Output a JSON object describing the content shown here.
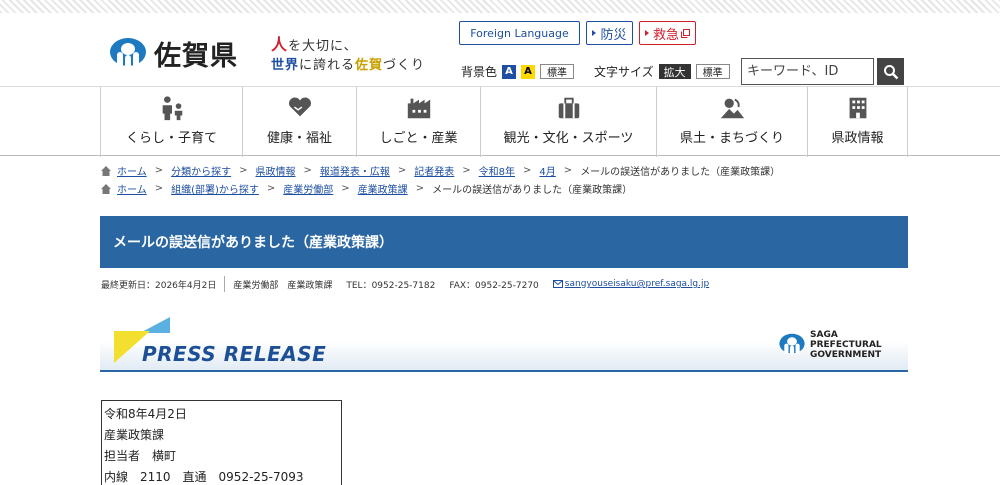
{
  "header": {
    "logo_text": "佐賀県",
    "slogan": {
      "line1_a": "人",
      "line1_b": "を大切に、",
      "line2_a": "世界",
      "line2_b": "に誇れる",
      "line2_c": "佐賀",
      "line2_d": "づくり"
    },
    "foreign_language": "Foreign Language",
    "bousai": "防災",
    "kyukyu": "救急",
    "bgcolor_label": "背景色",
    "bgcolor_blue": "A",
    "bgcolor_yellow": "A",
    "bgcolor_standard": "標準",
    "fontsize_label": "文字サイズ",
    "fontsize_enlarge": "拡大",
    "fontsize_standard": "標準",
    "search_placeholder": "キーワード、ID"
  },
  "nav": {
    "items": [
      {
        "label": "くらし・子育て",
        "icon": "family-icon"
      },
      {
        "label": "健康・福祉",
        "icon": "heart-hands-icon"
      },
      {
        "label": "しごと・産業",
        "icon": "factory-icon"
      },
      {
        "label": "観光・文化・スポーツ",
        "icon": "suitcase-icon"
      },
      {
        "label": "県土・まちづくり",
        "icon": "landscape-icon"
      },
      {
        "label": "県政情報",
        "icon": "building-icon"
      }
    ]
  },
  "breadcrumb1": [
    "ホーム",
    "分類から探す",
    "県政情報",
    "報道発表・広報",
    "記者発表",
    "令和8年",
    "4月",
    "メールの誤送信がありました（産業政策課）"
  ],
  "breadcrumb2": [
    "ホーム",
    "組織(部署)から探す",
    "産業労働部",
    "産業政策課",
    "メールの誤送信がありました（産業政策課）"
  ],
  "page": {
    "title": "メールの誤送信がありました（産業政策課）",
    "updated": "最終更新日：2026年4月2日",
    "dept": "産業労働部　産業政策課",
    "tel": "TEL：0952-25-7182",
    "fax": "FAX：0952-25-7270",
    "email": "sangyouseisaku@pref.saga.lg.jp"
  },
  "banner": {
    "press_release": "PRESS RELEASE",
    "gov_line1": "SAGA",
    "gov_line2": "PREFECTURAL",
    "gov_line3": "GOVERNMENT"
  },
  "info": {
    "date": "令和8年4月2日",
    "section": "産業政策課",
    "person": "担当者　横町",
    "phone": "内線　2110　直通　0952-25-7093"
  },
  "colors": {
    "brand_blue": "#2a66a1",
    "link_blue": "#1e4fa2",
    "emergency_red": "#d0202e"
  }
}
